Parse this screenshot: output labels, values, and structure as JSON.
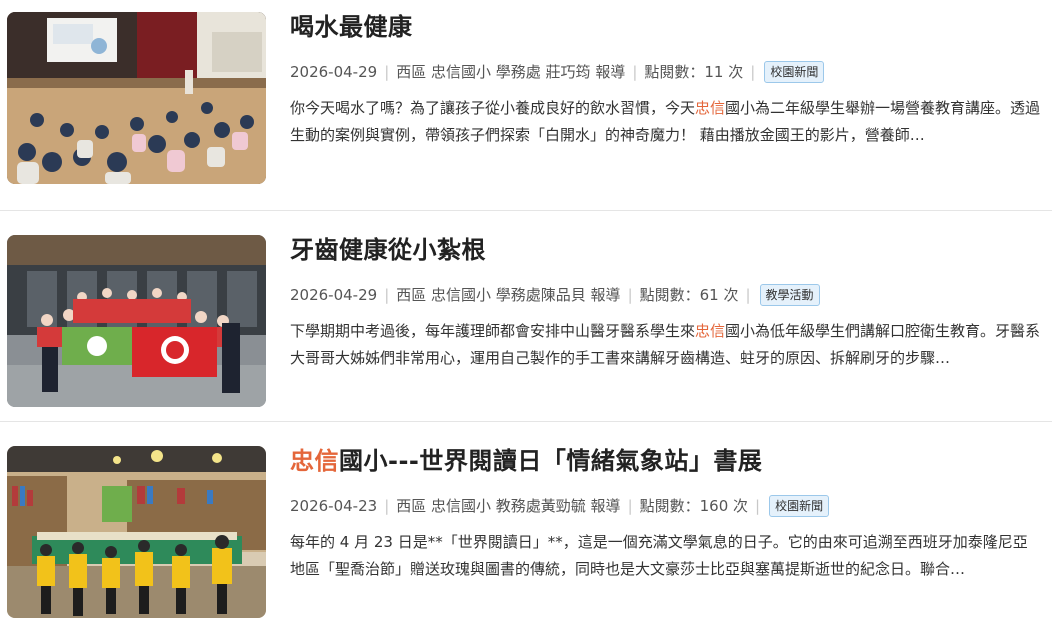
{
  "articles": [
    {
      "title_pre": "",
      "title_hl": "",
      "title_post": "喝水最健康",
      "date": "2026-04-29",
      "byline": "西區 忠信國小 學務處 莊巧筠 報導",
      "views": "點閱數：11 次",
      "category": "校園新聞",
      "excerpt_pre": "你今天喝水了嗎？為了讓孩子從小養成良好的飲水習慣，今天",
      "excerpt_hl": "忠信",
      "excerpt_post": "國小為二年級學生舉辦一場營養教育講座。透過生動的案例與實例，帶領孩子們探索「白開水」的神奇魔力！ 藉由播放金國王的影片，營養師…",
      "image": "students-sitting-in-auditorium-photo"
    },
    {
      "title_pre": "",
      "title_hl": "",
      "title_post": "牙齒健康從小紮根",
      "date": "2026-04-29",
      "byline": "西區 忠信國小 學務處陳品貝 報導",
      "views": "點閱數：61 次",
      "category": "教學活動",
      "excerpt_pre": "下學期期中考過後，每年護理師都會安排中山醫牙醫系學生來",
      "excerpt_hl": "忠信",
      "excerpt_post": "國小為低年級學生們講解口腔衛生教育。牙醫系大哥哥大姊姊們非常用心，運用自己製作的手工書來講解牙齒構造、蛀牙的原因、拆解刷牙的步驟…",
      "image": "dental-students-group-photo"
    },
    {
      "title_pre": "",
      "title_hl": "忠信",
      "title_post": "國小---世界閱讀日「情緒氣象站」書展",
      "date": "2026-04-23",
      "byline": "西區 忠信國小 教務處黃勁毓 報導",
      "views": "點閱數：160 次",
      "category": "校園新聞",
      "excerpt_pre": "每年的 4 月 23 日是**「世界閱讀日」**，這是一個充滿文學氣息的日子。它的由來可追溯至西班牙加泰隆尼亞地區「聖喬治節」贈送玫瑰與圖書的傳統，同時也是大文豪莎士比亞與塞萬提斯逝世的紀念日。聯合…",
      "excerpt_hl": "",
      "excerpt_post": "",
      "image": "library-book-exhibition-photo"
    }
  ]
}
